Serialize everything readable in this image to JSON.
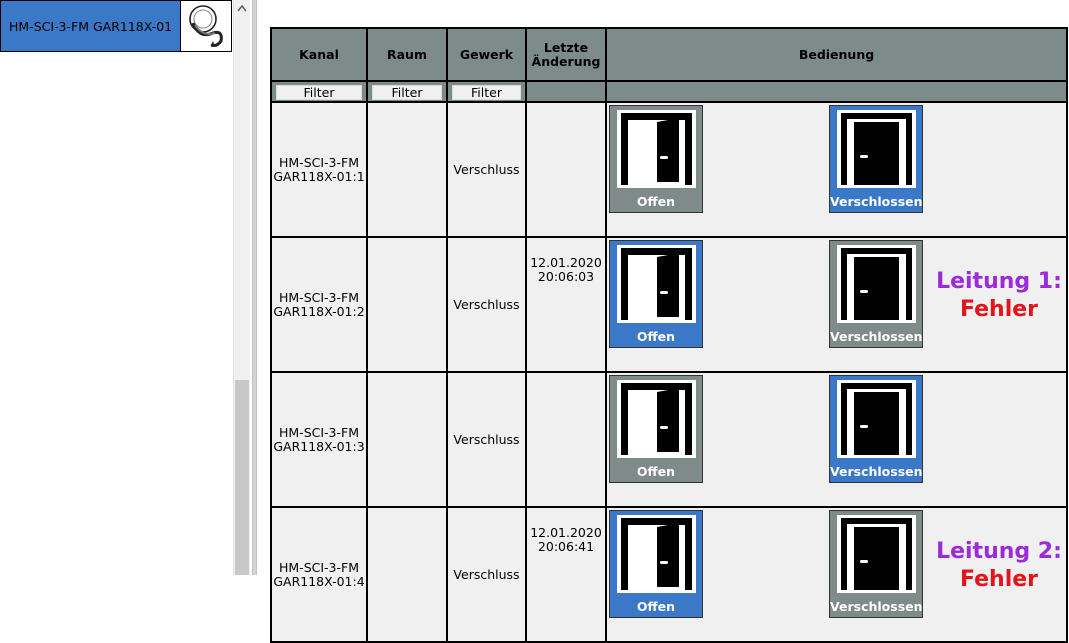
{
  "device_list": {
    "selected_device": "HM-SCI-3-FM GAR118X-01",
    "thumbnail_icon": "device-thumbnail-icon"
  },
  "table": {
    "headers": {
      "kanal": "Kanal",
      "raum": "Raum",
      "gewerk": "Gewerk",
      "letzte_aenderung_1": "Letzte",
      "letzte_aenderung_2": "Änderung",
      "bedienung": "Bedienung"
    },
    "filter_label": "Filter",
    "rows": [
      {
        "kanal_1": "HM-SCI-3-FM",
        "kanal_2": "GAR118X-01:1",
        "raum": "",
        "gewerk": "Verschluss",
        "date": "",
        "time": "",
        "offen_label": "Offen",
        "zu_label": "Verschlossen",
        "active": "verschlossen",
        "status_line": "",
        "status_error": ""
      },
      {
        "kanal_1": "HM-SCI-3-FM",
        "kanal_2": "GAR118X-01:2",
        "raum": "",
        "gewerk": "Verschluss",
        "date": "12.01.2020",
        "time": "20:06:03",
        "offen_label": "Offen",
        "zu_label": "Verschlossen",
        "active": "offen",
        "status_line": "Leitung 1:",
        "status_error": "Fehler"
      },
      {
        "kanal_1": "HM-SCI-3-FM",
        "kanal_2": "GAR118X-01:3",
        "raum": "",
        "gewerk": "Verschluss",
        "date": "",
        "time": "",
        "offen_label": "Offen",
        "zu_label": "Verschlossen",
        "active": "verschlossen",
        "status_line": "",
        "status_error": ""
      },
      {
        "kanal_1": "HM-SCI-3-FM",
        "kanal_2": "GAR118X-01:4",
        "raum": "",
        "gewerk": "Verschluss",
        "date": "12.01.2020",
        "time": "20:06:41",
        "offen_label": "Offen",
        "zu_label": "Verschlossen",
        "active": "offen",
        "status_line": "Leitung 2:",
        "status_error": "Fehler"
      }
    ]
  },
  "colors": {
    "header_bg": "#7d8c8a",
    "active_button": "#3b78c8",
    "inactive_button": "#7e8b89",
    "status_line": "#9b2ad8",
    "status_error": "#e2151b"
  },
  "icons": {
    "open_door": "open-door-icon",
    "closed_door": "closed-door-icon",
    "scroll_up": "chevron-up-icon"
  }
}
